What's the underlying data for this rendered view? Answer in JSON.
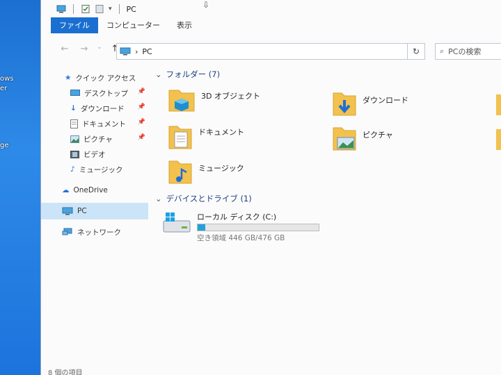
{
  "desktop": {
    "labels": [
      "ows",
      "er",
      "ge"
    ]
  },
  "titlebar": {
    "title": "PC"
  },
  "ribbon": {
    "tabs": [
      "ファイル",
      "コンピューター",
      "表示"
    ]
  },
  "address": {
    "path": "PC",
    "separator": "›"
  },
  "search": {
    "placeholder": "PCの検索"
  },
  "nav": {
    "items": [
      {
        "label": "クイック アクセス"
      },
      {
        "label": "デスクトップ"
      },
      {
        "label": "ダウンロード"
      },
      {
        "label": "ドキュメント"
      },
      {
        "label": "ピクチャ"
      },
      {
        "label": "ビデオ"
      },
      {
        "label": "ミュージック"
      },
      {
        "label": "OneDrive"
      },
      {
        "label": "PC"
      },
      {
        "label": "ネットワーク"
      }
    ]
  },
  "folders": {
    "header": "フォルダー (7)",
    "items": [
      {
        "label": "3D オブジェクト"
      },
      {
        "label": "ダウンロード"
      },
      {
        "label": "ドキュメント"
      },
      {
        "label": "ピクチャ"
      },
      {
        "label": "ミュージック"
      }
    ]
  },
  "devices": {
    "header": "デバイスとドライブ (1)",
    "drive": {
      "label": "ローカル ディスク (C:)",
      "free_text": "空き領域 446 GB/476 GB",
      "used_fraction": 0.063
    }
  },
  "status": {
    "text": "8 個の項目"
  },
  "colors": {
    "accent": "#1a6fd1",
    "folder": "#f2c14e",
    "drive_bar": "#26a0da"
  }
}
